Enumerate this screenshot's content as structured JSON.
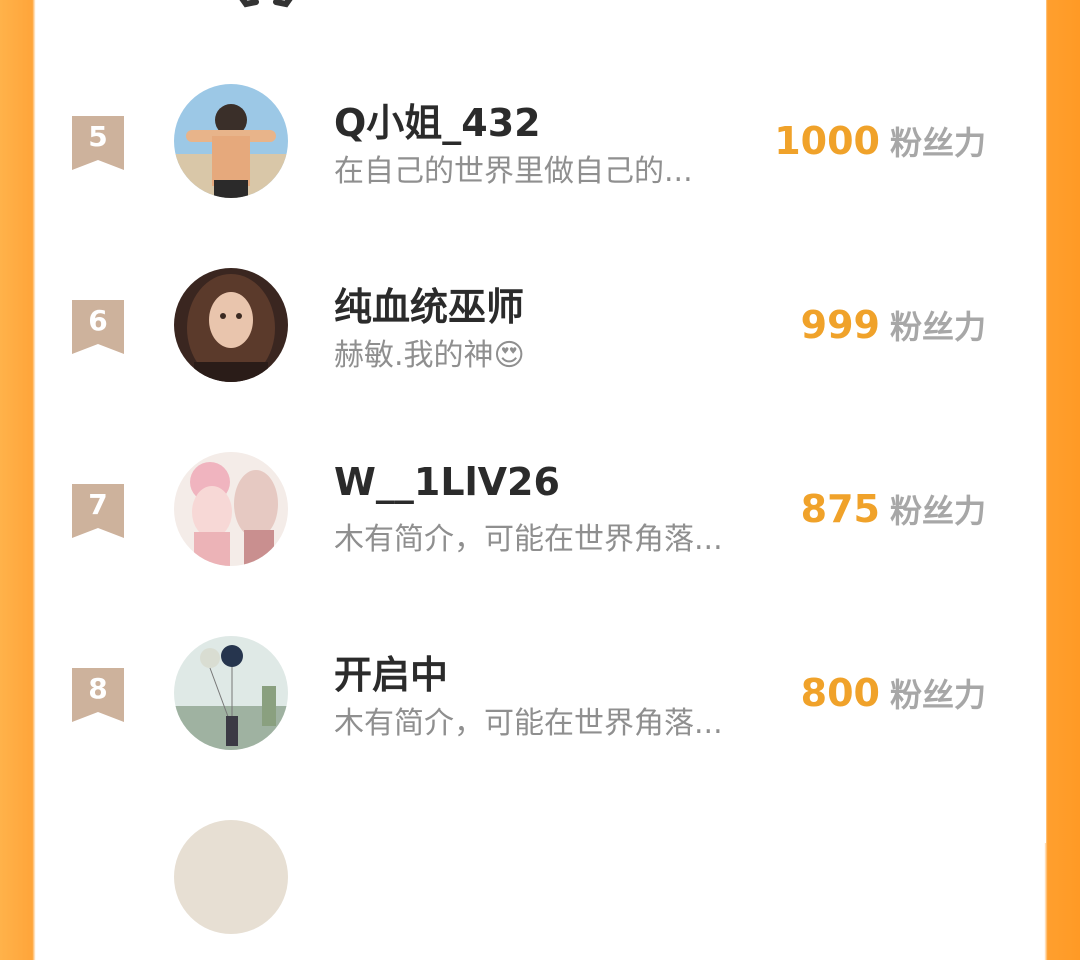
{
  "colors": {
    "accent": "#f0a22a",
    "border_orange": "#ffa53a",
    "rank_badge": "#cdb29c",
    "name": "#2b2b2b",
    "bio": "#8f8f8f",
    "unit": "#a7a7a7"
  },
  "ranking": {
    "score_unit": "粉丝力",
    "items": [
      {
        "rank": "5",
        "name": "Q小姐_432",
        "bio": "在自己的世界里做自己的...",
        "score": "1000",
        "avatar": "avatar-anime-boy"
      },
      {
        "rank": "6",
        "name": "纯血统巫师",
        "bio": "赫敏.我的神😍",
        "score": "999",
        "avatar": "avatar-girl-photo"
      },
      {
        "rank": "7",
        "name": "W__1LlV26",
        "bio": "木有简介，可能在世界角落...",
        "score": "875",
        "avatar": "avatar-anime-couple"
      },
      {
        "rank": "8",
        "name": "开启中",
        "bio": "木有简介，可能在世界角落...",
        "score": "800",
        "avatar": "avatar-balloons"
      }
    ]
  }
}
